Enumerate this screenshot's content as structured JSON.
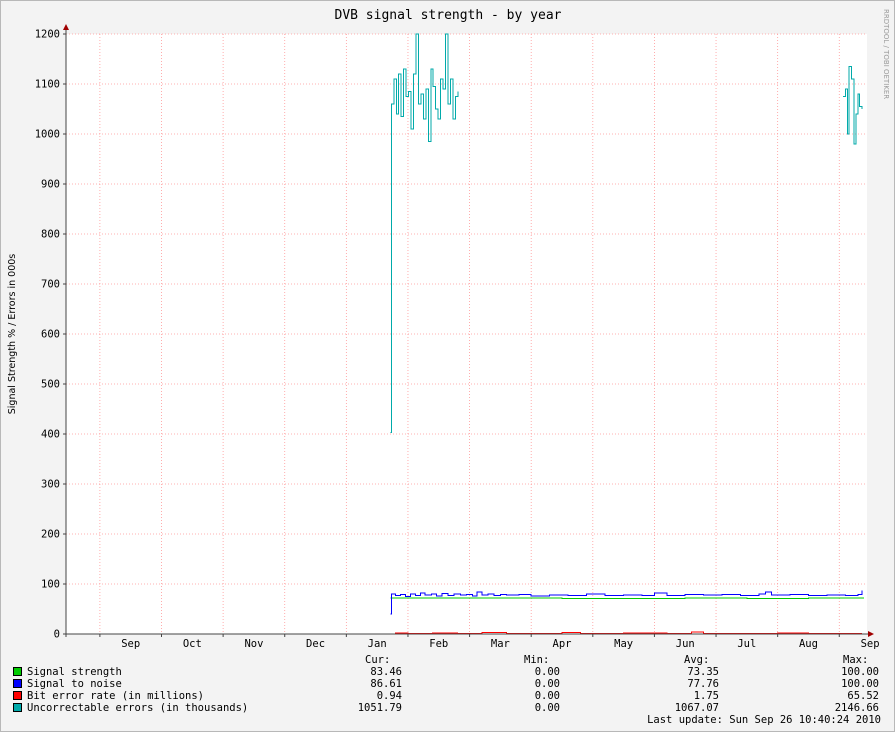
{
  "title": "DVB signal strength - by year",
  "watermark": "RRDTOOL / TOBI OETIKER",
  "chart_data": {
    "type": "line",
    "title": "DVB signal strength - by year",
    "ylabel": "Signal Strength % / Errors in 000s",
    "xlabel": "",
    "ylim": [
      0,
      1200
    ],
    "yticks": [
      0,
      100,
      200,
      300,
      400,
      500,
      600,
      700,
      800,
      900,
      1000,
      1100,
      1200
    ],
    "xlim_months": [
      7.45,
      20.45
    ],
    "month_labels": [
      {
        "label": "Sep",
        "pos": 8.5
      },
      {
        "label": "Oct",
        "pos": 9.5
      },
      {
        "label": "Nov",
        "pos": 10.5
      },
      {
        "label": "Dec",
        "pos": 11.5
      },
      {
        "label": "Jan",
        "pos": 12.5
      },
      {
        "label": "Feb",
        "pos": 13.5
      },
      {
        "label": "Mar",
        "pos": 14.5
      },
      {
        "label": "Apr",
        "pos": 15.5
      },
      {
        "label": "May",
        "pos": 16.5
      },
      {
        "label": "Jun",
        "pos": 17.5
      },
      {
        "label": "Jul",
        "pos": 18.5
      },
      {
        "label": "Aug",
        "pos": 19.5
      },
      {
        "label": "Sep",
        "pos": 20.5
      }
    ],
    "grid": true,
    "series": [
      {
        "name": "Signal strength",
        "color": "#00cc00",
        "segments": [
          [
            [
              12.72,
              72
            ],
            [
              13.5,
              72
            ],
            [
              14.6,
              72
            ],
            [
              15.5,
              71
            ],
            [
              16.5,
              71
            ],
            [
              17.5,
              72
            ],
            [
              18.5,
              71
            ],
            [
              19.5,
              72
            ],
            [
              20.4,
              72
            ]
          ]
        ]
      },
      {
        "name": "Signal to noise",
        "color": "#0000ff",
        "segments": [
          [
            [
              12.72,
              40
            ],
            [
              12.73,
              80
            ],
            [
              12.8,
              77
            ],
            [
              12.88,
              79
            ],
            [
              12.96,
              75
            ],
            [
              13.04,
              80
            ],
            [
              13.12,
              77
            ],
            [
              13.2,
              82
            ],
            [
              13.28,
              78
            ],
            [
              13.38,
              80
            ],
            [
              13.46,
              76
            ],
            [
              13.55,
              81
            ],
            [
              13.65,
              77
            ],
            [
              13.75,
              80
            ],
            [
              13.85,
              78
            ],
            [
              13.95,
              79
            ],
            [
              14.05,
              76
            ],
            [
              14.12,
              84
            ],
            [
              14.2,
              78
            ],
            [
              14.3,
              80
            ],
            [
              14.4,
              77
            ],
            [
              14.5,
              79
            ],
            [
              14.6,
              78
            ],
            [
              14.8,
              79
            ],
            [
              15.0,
              76
            ],
            [
              15.3,
              78
            ],
            [
              15.6,
              77
            ],
            [
              15.9,
              80
            ],
            [
              16.2,
              77
            ],
            [
              16.5,
              78
            ],
            [
              16.8,
              77
            ],
            [
              17.0,
              82
            ],
            [
              17.2,
              77
            ],
            [
              17.5,
              79
            ],
            [
              17.8,
              78
            ],
            [
              18.1,
              79
            ],
            [
              18.4,
              77
            ],
            [
              18.7,
              80
            ],
            [
              18.8,
              84
            ],
            [
              18.9,
              78
            ],
            [
              19.2,
              79
            ],
            [
              19.5,
              77
            ],
            [
              19.8,
              78
            ],
            [
              20.1,
              77
            ],
            [
              20.3,
              79
            ],
            [
              20.37,
              87
            ]
          ]
        ]
      },
      {
        "name": "Bit error rate (in millions)",
        "color": "#ff0000",
        "segments": [
          [
            [
              12.72,
              0
            ],
            [
              12.8,
              2
            ],
            [
              13.0,
              1
            ],
            [
              13.4,
              2
            ],
            [
              13.8,
              1
            ],
            [
              14.2,
              3
            ],
            [
              14.6,
              1
            ],
            [
              15.2,
              1
            ],
            [
              15.5,
              3
            ],
            [
              15.8,
              1
            ],
            [
              16.5,
              2
            ],
            [
              17.2,
              1
            ],
            [
              17.6,
              4
            ],
            [
              17.8,
              1
            ],
            [
              18.5,
              1
            ],
            [
              19.0,
              2
            ],
            [
              19.5,
              1
            ],
            [
              20.0,
              1
            ],
            [
              20.37,
              1
            ]
          ]
        ]
      },
      {
        "name": "Uncorrectable errors (in thousands)",
        "color": "#00aaaa",
        "segments": [
          [
            [
              12.72,
              403
            ],
            [
              12.73,
              1060
            ],
            [
              12.77,
              1110
            ],
            [
              12.81,
              1040
            ],
            [
              12.85,
              1120
            ],
            [
              12.89,
              1035
            ],
            [
              12.93,
              1130
            ],
            [
              12.97,
              1075
            ],
            [
              13.01,
              1085
            ],
            [
              13.05,
              1010
            ],
            [
              13.09,
              1120
            ],
            [
              13.13,
              1200
            ],
            [
              13.17,
              1060
            ],
            [
              13.21,
              1080
            ],
            [
              13.25,
              1030
            ],
            [
              13.29,
              1090
            ],
            [
              13.33,
              985
            ],
            [
              13.37,
              1130
            ],
            [
              13.41,
              1095
            ],
            [
              13.45,
              1050
            ],
            [
              13.49,
              1030
            ],
            [
              13.53,
              1110
            ],
            [
              13.57,
              1090
            ],
            [
              13.61,
              1200
            ],
            [
              13.65,
              1060
            ],
            [
              13.69,
              1110
            ],
            [
              13.73,
              1030
            ],
            [
              13.77,
              1075
            ],
            [
              13.81,
              1085
            ]
          ],
          [
            [
              20.06,
              1075
            ],
            [
              20.1,
              1090
            ],
            [
              20.13,
              1000
            ],
            [
              20.16,
              1135
            ],
            [
              20.2,
              1110
            ],
            [
              20.24,
              980
            ],
            [
              20.27,
              1040
            ],
            [
              20.3,
              1080
            ],
            [
              20.33,
              1055
            ],
            [
              20.37,
              1050
            ]
          ]
        ]
      }
    ]
  },
  "stats": {
    "headers": {
      "cur": "Cur:",
      "min": "Min:",
      "avg": "Avg:",
      "max": "Max:"
    },
    "rows": [
      {
        "name": "Signal strength",
        "color": "#00cc00",
        "cur": "83.46",
        "min": "0.00",
        "avg": "73.35",
        "max": "100.00"
      },
      {
        "name": "Signal to noise",
        "color": "#0000ff",
        "cur": "86.61",
        "min": "0.00",
        "avg": "77.76",
        "max": "100.00"
      },
      {
        "name": "Bit error rate (in millions)",
        "color": "#ff0000",
        "cur": "0.94",
        "min": "0.00",
        "avg": "1.75",
        "max": "65.52"
      },
      {
        "name": "Uncorrectable errors (in thousands)",
        "color": "#00aaaa",
        "cur": "1051.79",
        "min": "0.00",
        "avg": "1067.07",
        "max": "2146.66"
      }
    ]
  },
  "last_update": "Last update: Sun Sep 26 10:40:24 2010"
}
